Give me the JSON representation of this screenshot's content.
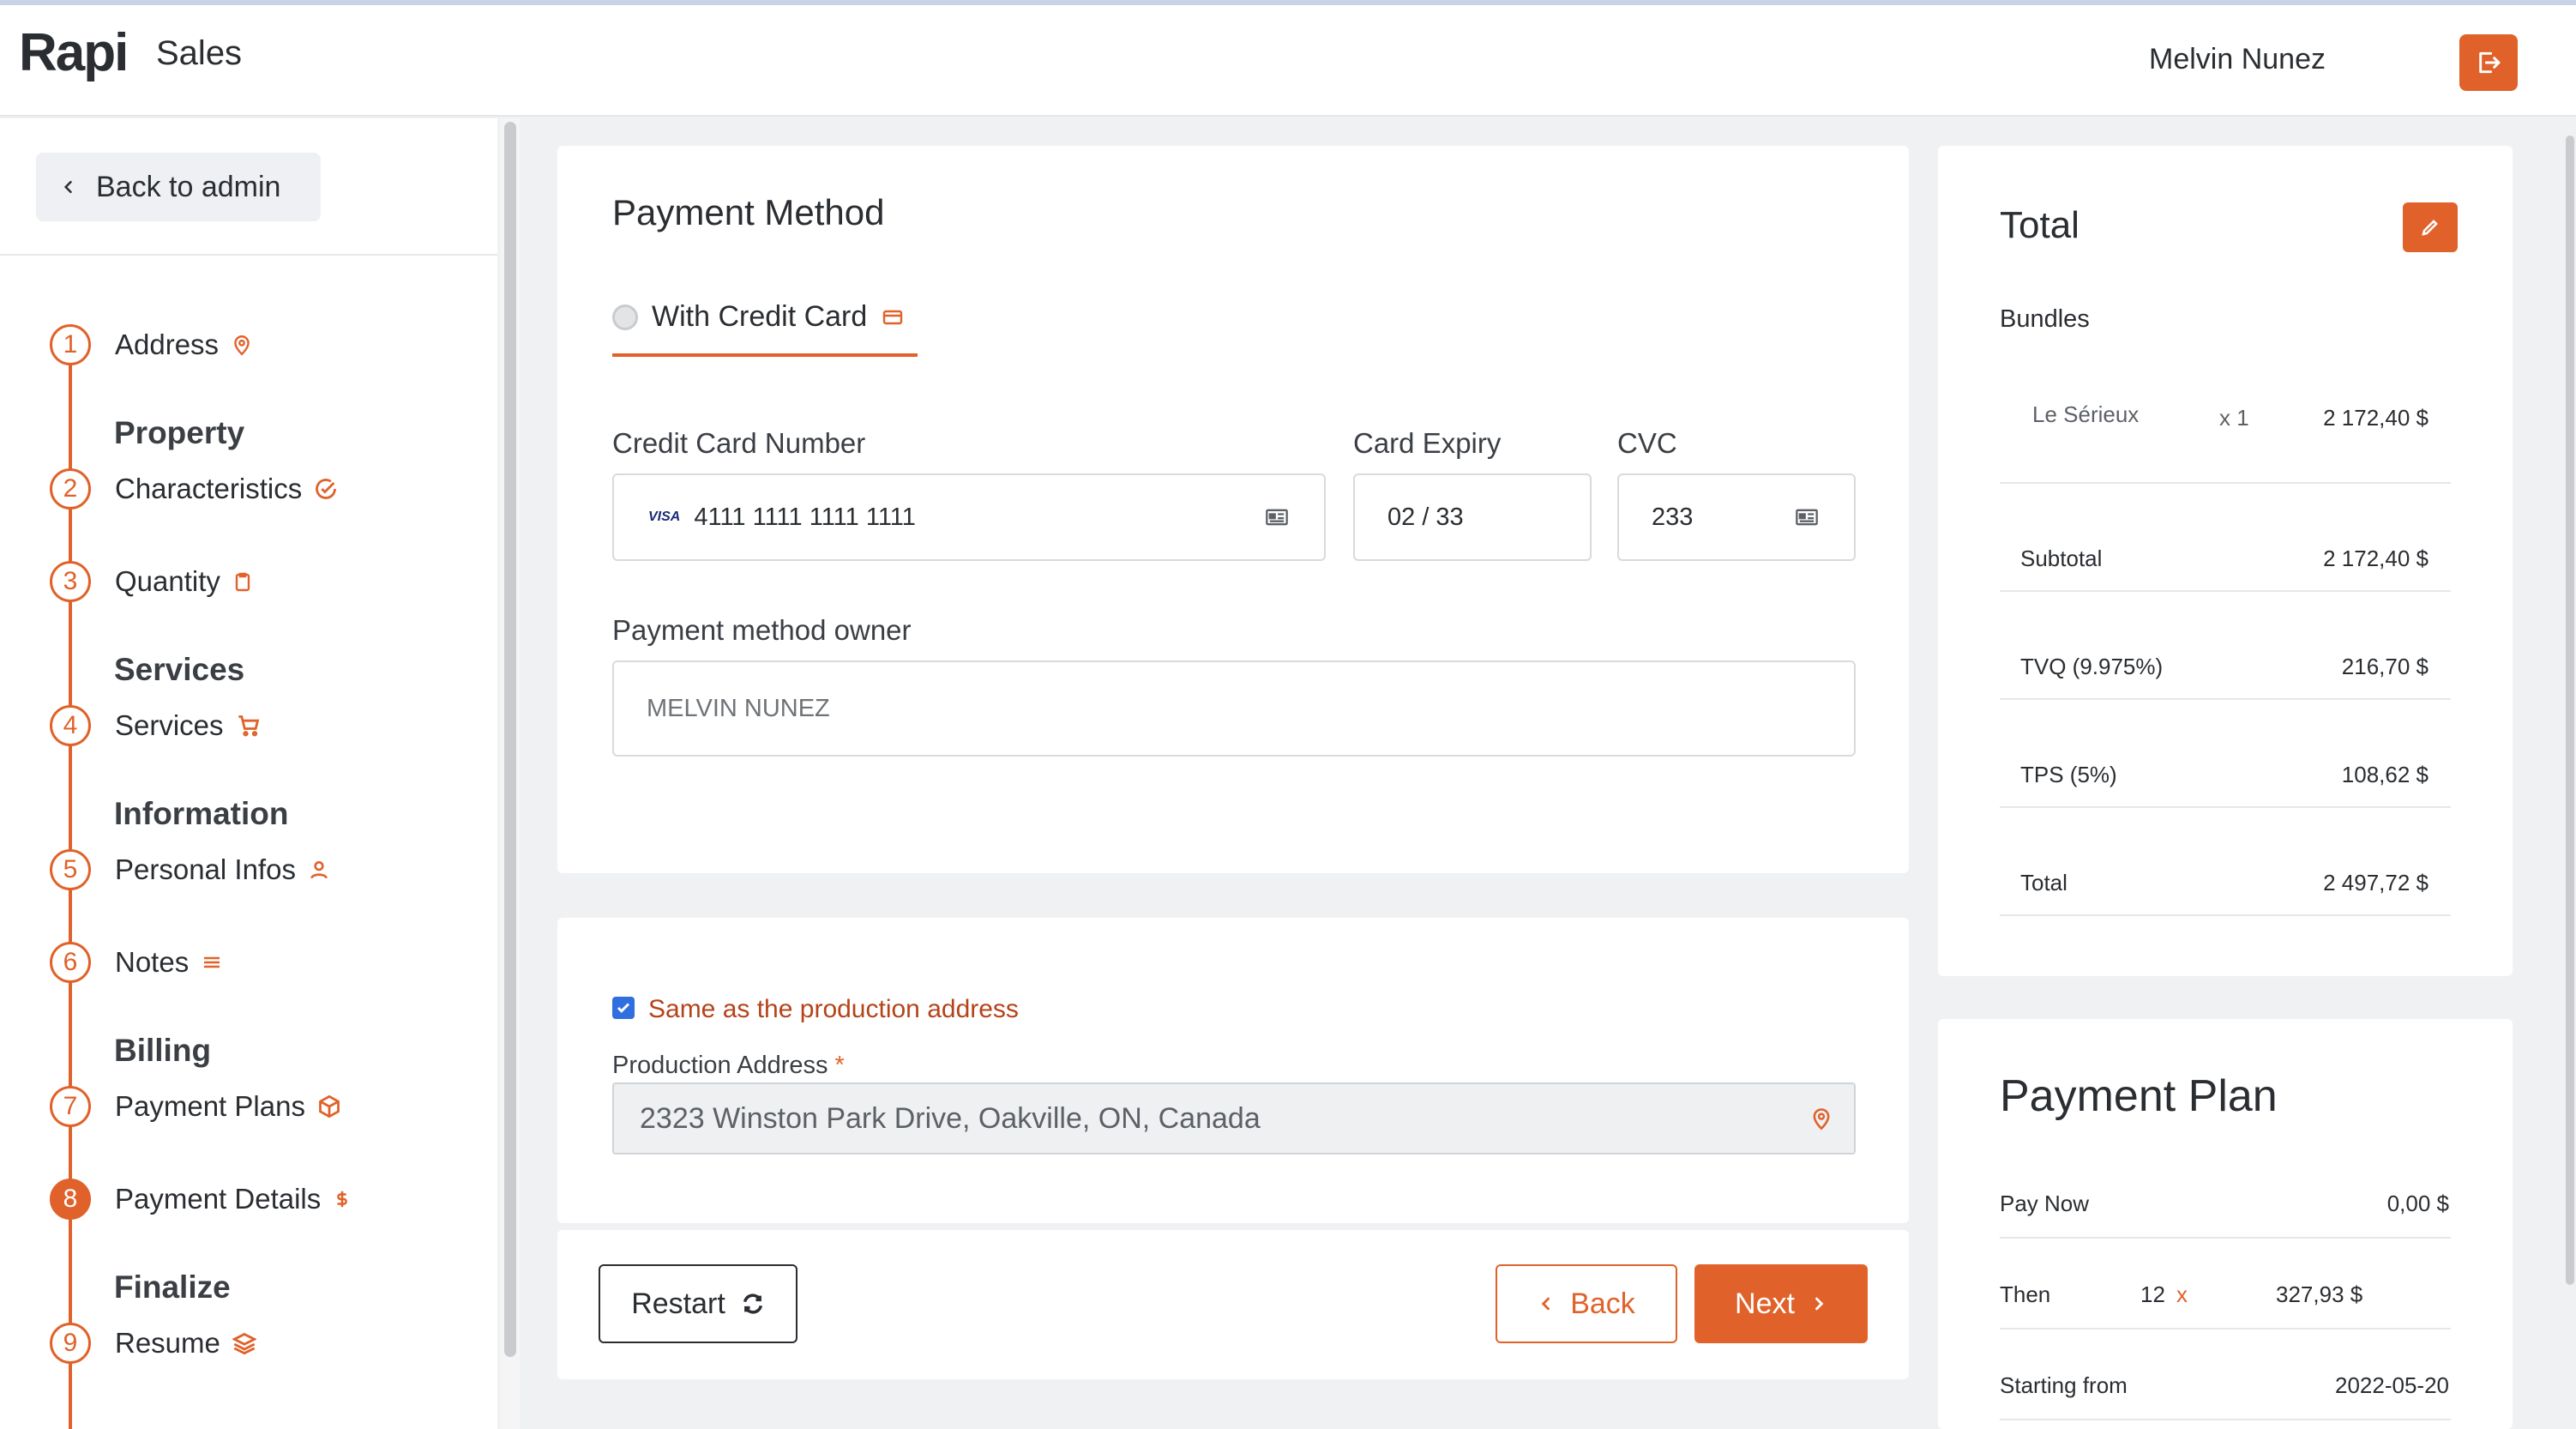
{
  "header": {
    "logo": "Rapi",
    "app_name": "Sales",
    "user_name": "Melvin Nunez"
  },
  "sidebar": {
    "back_label": "Back to admin",
    "groups": [
      "Property",
      "Services",
      "Information",
      "Billing",
      "Finalize"
    ],
    "steps": [
      {
        "num": "1",
        "label": "Address",
        "icon": "map-pin-icon"
      },
      {
        "num": "2",
        "label": "Characteristics",
        "icon": "check-circle-icon"
      },
      {
        "num": "3",
        "label": "Quantity",
        "icon": "clipboard-icon"
      },
      {
        "num": "4",
        "label": "Services",
        "icon": "cart-icon"
      },
      {
        "num": "5",
        "label": "Personal Infos",
        "icon": "user-icon"
      },
      {
        "num": "6",
        "label": "Notes",
        "icon": "notes-icon"
      },
      {
        "num": "7",
        "label": "Payment Plans",
        "icon": "box-icon"
      },
      {
        "num": "8",
        "label": "Payment Details",
        "icon": "dollar-icon",
        "active": true
      },
      {
        "num": "9",
        "label": "Resume",
        "icon": "layers-icon"
      }
    ]
  },
  "payment": {
    "title": "Payment Method",
    "tab_label": "With Credit Card",
    "card_number_label": "Credit Card Number",
    "card_number": "4111 1111 1111 1111",
    "card_brand": "VISA",
    "expiry_label": "Card Expiry",
    "expiry": "02 / 33",
    "cvc_label": "CVC",
    "cvc": "233",
    "owner_label": "Payment method owner",
    "owner": "MELVIN NUNEZ"
  },
  "address": {
    "same_label": "Same as the production address",
    "same_checked": true,
    "production_label": "Production Address",
    "required_mark": "*",
    "production_value": "2323 Winston Park Drive, Oakville, ON, Canada"
  },
  "actions": {
    "restart": "Restart",
    "back": "Back",
    "next": "Next"
  },
  "total": {
    "title": "Total",
    "bundles_label": "Bundles",
    "bundle_name": "Le Sérieux",
    "bundle_qty": "x 1",
    "bundle_price": "2 172,40 $",
    "rows": [
      {
        "label": "Subtotal",
        "value": "2 172,40 $"
      },
      {
        "label": "TVQ (9.975%)",
        "value": "216,70 $"
      },
      {
        "label": "TPS (5%)",
        "value": "108,62 $"
      },
      {
        "label": "Total",
        "value": "2 497,72 $"
      }
    ]
  },
  "plan": {
    "title": "Payment Plan",
    "pay_now_label": "Pay Now",
    "pay_now_value": "0,00 $",
    "then_label": "Then",
    "then_count": "12",
    "then_x": "x",
    "then_value": "327,93 $",
    "start_label": "Starting from",
    "start_value": "2022-05-20"
  },
  "colors": {
    "accent": "#e0622a",
    "accent_dark": "#b5431a",
    "checkbox": "#2f6fe0"
  }
}
